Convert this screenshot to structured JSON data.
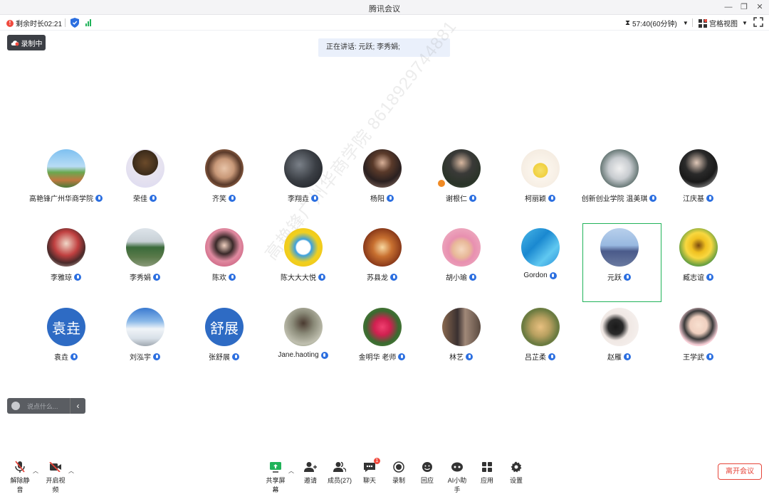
{
  "window": {
    "title": "腾讯会议"
  },
  "topbar": {
    "remaining": "剩余时长02:21",
    "timer": "57:40(60分钟)",
    "view": "宫格视图"
  },
  "record_badge": "录制中",
  "speaking": "正在讲话: 元跃; 李秀娟;",
  "watermark": "高艳锋广州华商学院 8618929744881",
  "participants": [
    {
      "name": "高艳锋广州华商学院"
    },
    {
      "name": "荣佳"
    },
    {
      "name": "齐笑"
    },
    {
      "name": "李翔垚"
    },
    {
      "name": "杨阳"
    },
    {
      "name": "谢根仁"
    },
    {
      "name": "柯丽颖"
    },
    {
      "name": "创新创业学院 温美琪"
    },
    {
      "name": "江庆基"
    },
    {
      "name": "李雅琼"
    },
    {
      "name": "李秀娟"
    },
    {
      "name": "陈欢"
    },
    {
      "name": "陈大大大悦"
    },
    {
      "name": "苏县龙"
    },
    {
      "name": "胡小瑜"
    },
    {
      "name": "Gordon"
    },
    {
      "name": "元跃"
    },
    {
      "name": "臧志谊"
    },
    {
      "name": "袁垚",
      "avatar_text": "袁垚"
    },
    {
      "name": "刘泓宇"
    },
    {
      "name": "张舒展",
      "avatar_text": "舒展"
    },
    {
      "name": "Jane.haoting"
    },
    {
      "name": "金明华 老师"
    },
    {
      "name": "林艺"
    },
    {
      "name": "吕芷柔"
    },
    {
      "name": "赵雁"
    },
    {
      "name": "王学武"
    }
  ],
  "chat": {
    "placeholder": "说点什么..."
  },
  "toolbar": {
    "unmute": "解除静音",
    "video": "开启视频",
    "share": "共享屏幕",
    "invite": "邀请",
    "members": "成员(27)",
    "chat": "聊天",
    "chat_badge": "1",
    "record": "录制",
    "replay": "回应",
    "ai": "AI小助手",
    "apps": "应用",
    "settings": "设置",
    "leave": "离开会议"
  },
  "colors": {
    "accent": "#2c6fe0",
    "active_frame": "#21b35a",
    "leave": "#e6453a"
  }
}
